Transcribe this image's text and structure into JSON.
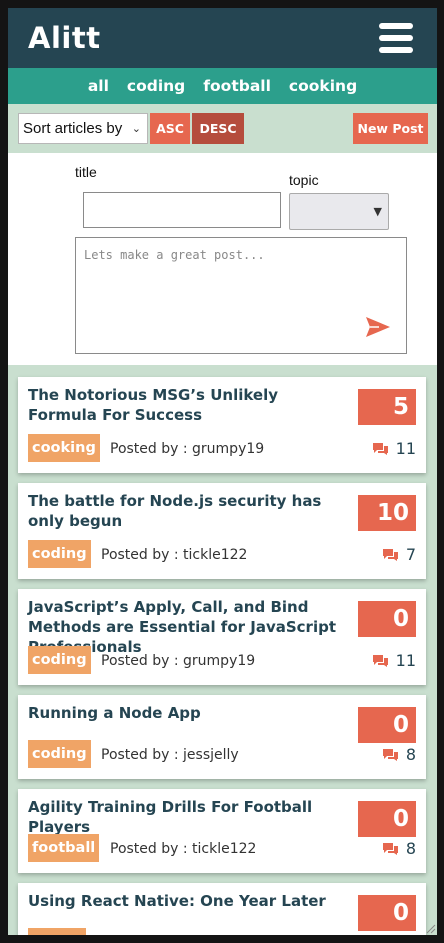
{
  "header": {
    "logo": "Alitt",
    "menu_icon": "hamburger-icon"
  },
  "nav": {
    "topics": [
      "all",
      "coding",
      "football",
      "cooking"
    ]
  },
  "sort": {
    "select_label": "Sort articles by",
    "asc_label": "ASC",
    "desc_label": "DESC",
    "new_post_label": "New Post"
  },
  "form": {
    "title_label": "title",
    "topic_label": "topic",
    "body_placeholder": "Lets make a great post...",
    "send_icon": "send-icon"
  },
  "colors": {
    "header": "#254552",
    "nav": "#2c9f8c",
    "accent": "#e6674f",
    "desc": "#b54d3d",
    "tag": "#f0a466",
    "background": "#c9dfcf"
  },
  "articles": [
    {
      "title": "The Notorious MSG’s Unlikely Formula For Success",
      "votes": "5",
      "topic": "cooking",
      "posted_by": "Posted by : grumpy19",
      "comments": "11"
    },
    {
      "title": "The battle for Node.js security has only begun",
      "votes": "10",
      "topic": "coding",
      "posted_by": "Posted by : tickle122",
      "comments": "7"
    },
    {
      "title": "JavaScript’s Apply, Call, and Bind Methods are Essential for JavaScript Professionals",
      "votes": "0",
      "topic": "coding",
      "posted_by": "Posted by : grumpy19",
      "comments": "11"
    },
    {
      "title": "Running a Node App",
      "votes": "0",
      "topic": "coding",
      "posted_by": "Posted by : jessjelly",
      "comments": "8"
    },
    {
      "title": "Agility Training Drills For Football Players",
      "votes": "0",
      "topic": "football",
      "posted_by": "Posted by : tickle122",
      "comments": "8"
    },
    {
      "title": "Using React Native: One Year Later",
      "votes": "0",
      "topic": "",
      "posted_by": "",
      "comments": ""
    }
  ]
}
